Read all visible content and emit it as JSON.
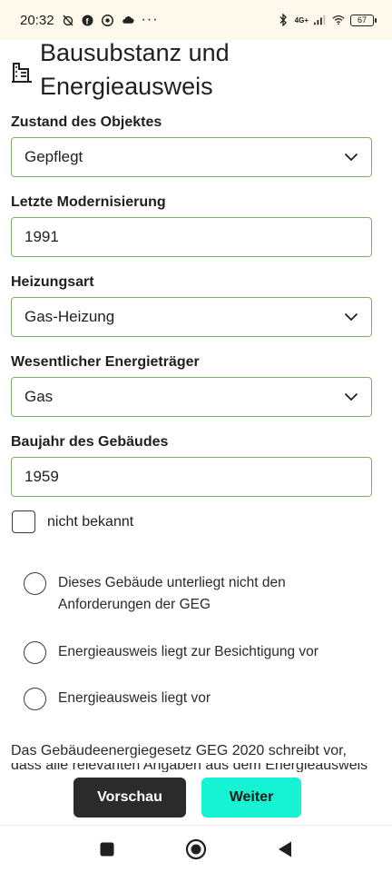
{
  "status_bar": {
    "time": "20:32",
    "battery": "67",
    "network": "4G+"
  },
  "header": {
    "title": "Bausubstanz und Energieausweis",
    "icon": "building-icon"
  },
  "form": {
    "condition": {
      "label": "Zustand des Objektes",
      "value": "Gepflegt"
    },
    "modernization": {
      "label": "Letzte Modernisierung",
      "value": "1991"
    },
    "heating": {
      "label": "Heizungsart",
      "value": "Gas-Heizung"
    },
    "energy_carrier": {
      "label": "Wesentlicher Energieträger",
      "value": "Gas"
    },
    "year_built": {
      "label": "Baujahr des Gebäudes",
      "value": "1959"
    },
    "unknown_checkbox": {
      "label": "nicht bekannt",
      "checked": false
    }
  },
  "radios": [
    {
      "label": "Dieses Gebäude unterliegt nicht den Anforderungen der GEG",
      "selected": false
    },
    {
      "label": "Energieausweis liegt zur Besichtigung vor",
      "selected": false
    },
    {
      "label": "Energieausweis liegt vor",
      "selected": false
    }
  ],
  "note": "Das Gebäudeenergiegesetz GEG 2020 schreibt vor,",
  "note_cut": "dass alle relevanten Angaben aus dem Energieausweis",
  "actions": {
    "preview": "Vorschau",
    "next": "Weiter"
  },
  "colors": {
    "accent_border": "#7fb069",
    "next_button": "#16f2d4",
    "preview_button": "#2b2b2b",
    "status_bar_bg": "#fff8ed"
  }
}
